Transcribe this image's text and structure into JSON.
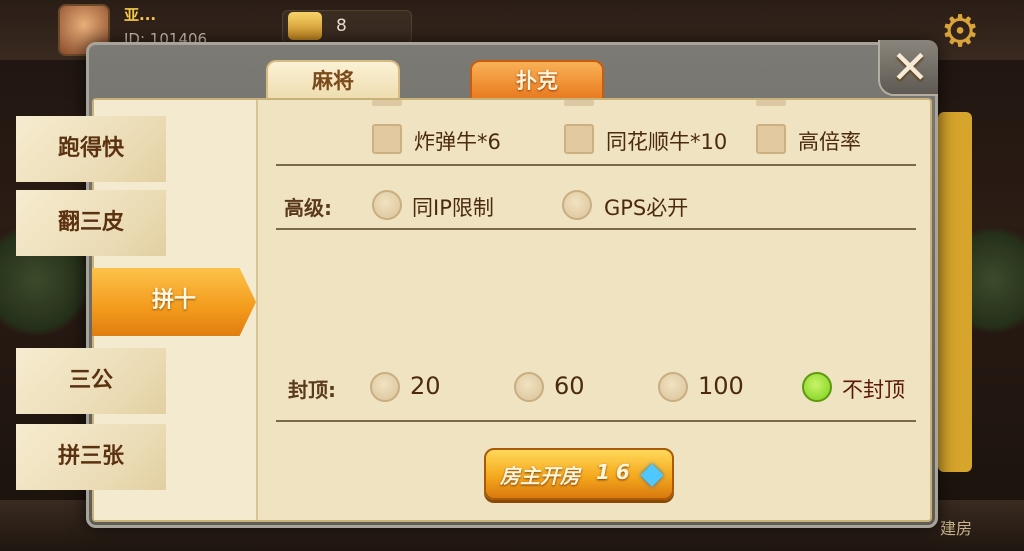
{
  "player": {
    "name": "亚...",
    "id_label": "ID: 101406",
    "coins": "8"
  },
  "bottom_bar": {
    "right_label": "建房"
  },
  "tabs": [
    {
      "label": "麻将"
    },
    {
      "label": "扑克"
    }
  ],
  "sidebar": {
    "items": [
      {
        "label": "跑得快"
      },
      {
        "label": "翻三皮"
      },
      {
        "label": "拼十",
        "active": true
      },
      {
        "label": "三公"
      },
      {
        "label": "拼三张"
      }
    ]
  },
  "options": {
    "special": [
      {
        "label": "炸弹牛*6"
      },
      {
        "label": "同花顺牛*10"
      },
      {
        "label": "高倍率"
      }
    ],
    "advanced": {
      "label": "高级:",
      "items": [
        {
          "label": "同IP限制"
        },
        {
          "label": "GPS必开"
        }
      ]
    },
    "cap": {
      "label": "封顶:",
      "items": [
        {
          "label": "20",
          "selected": false
        },
        {
          "label": "60",
          "selected": false
        },
        {
          "label": "100",
          "selected": false
        },
        {
          "label": "不封顶",
          "selected": true
        }
      ]
    }
  },
  "create_button": {
    "label": "房主开房",
    "cost": "16"
  },
  "icons": {
    "close": "close-icon",
    "settings": "gear-icon",
    "diamond": "diamond-icon"
  },
  "colors": {
    "accent": "#f39a1c",
    "panel": "#efe3c2",
    "selected_radio": "#7ccf1a"
  }
}
